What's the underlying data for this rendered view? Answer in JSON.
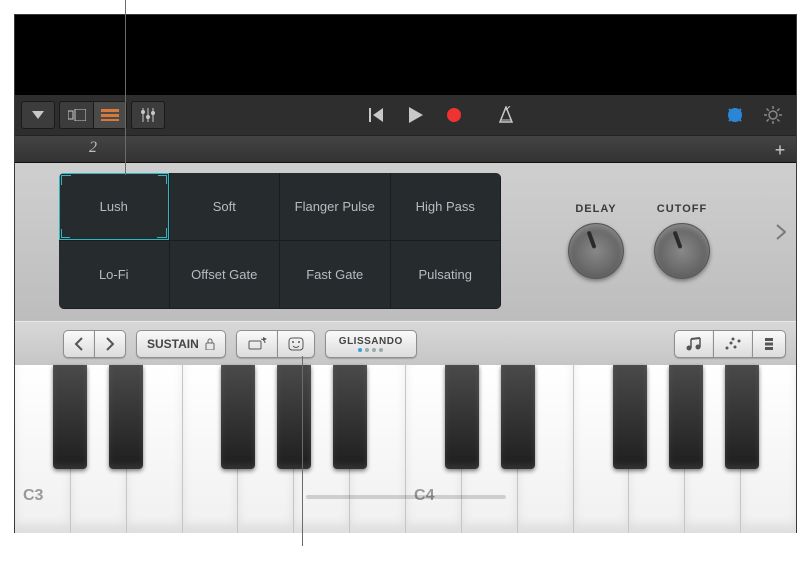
{
  "toolbar": {
    "dropdown_icon": "▼",
    "view_split_icon": "split",
    "view_list_icon": "list",
    "mixer_icon": "sliders",
    "prev_icon": "⏮",
    "play_icon": "▶",
    "record_icon": "●",
    "metronome_icon": "△",
    "master_icon": "◉",
    "settings_icon": "⚙"
  },
  "ruler": {
    "position_label": "2",
    "add_label": "+"
  },
  "presets": {
    "items": [
      {
        "label": "Lush",
        "selected": true
      },
      {
        "label": "Soft",
        "selected": false
      },
      {
        "label": "Flanger Pulse",
        "selected": false
      },
      {
        "label": "High Pass",
        "selected": false
      },
      {
        "label": "Lo-Fi",
        "selected": false
      },
      {
        "label": "Offset Gate",
        "selected": false
      },
      {
        "label": "Fast Gate",
        "selected": false
      },
      {
        "label": "Pulsating",
        "selected": false
      }
    ]
  },
  "knobs": {
    "delay_label": "DELAY",
    "cutoff_label": "CUTOFF"
  },
  "controls": {
    "octave_prev": "‹",
    "octave_next": "›",
    "sustain_label": "SUSTAIN",
    "glissando_label": "GLISSANDO"
  },
  "keyboard": {
    "c3_label": "C3",
    "c4_label": "C4"
  }
}
